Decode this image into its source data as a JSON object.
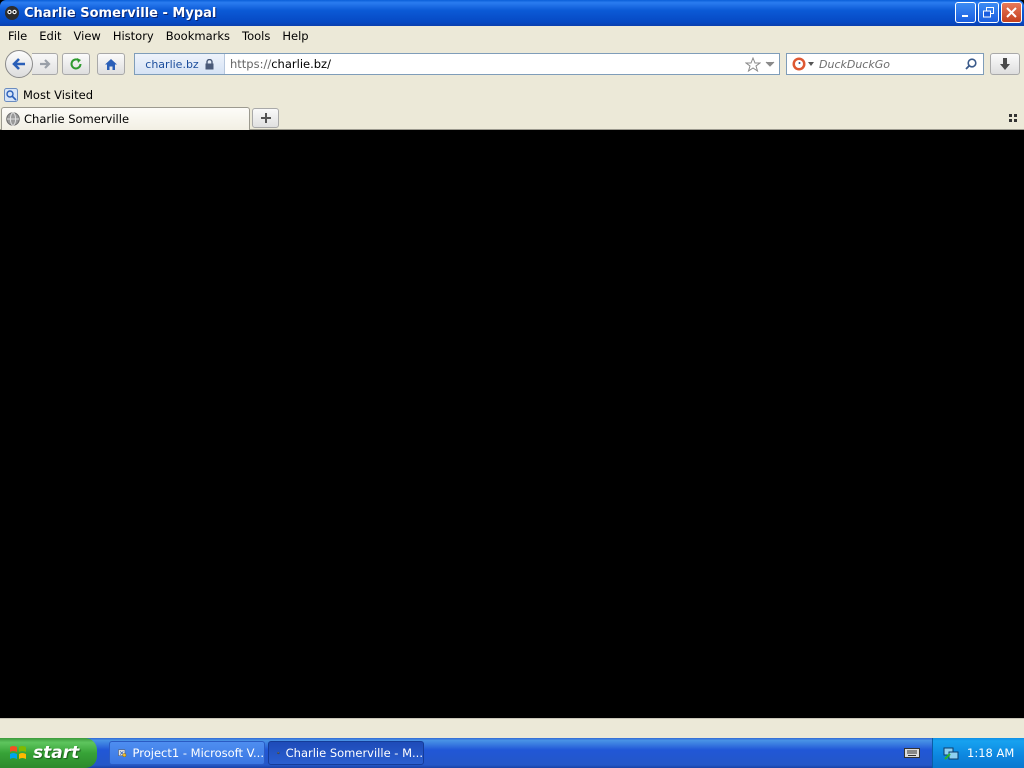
{
  "window": {
    "title": "Charlie Somerville - Mypal"
  },
  "menu": {
    "items": [
      {
        "label": "File"
      },
      {
        "label": "Edit"
      },
      {
        "label": "View"
      },
      {
        "label": "History"
      },
      {
        "label": "Bookmarks"
      },
      {
        "label": "Tools"
      },
      {
        "label": "Help"
      }
    ]
  },
  "navbar": {
    "identity_label": "charlie.bz",
    "url_scheme": "https://",
    "url_rest": "charlie.bz/",
    "search_engine": "DuckDuckGo",
    "search_placeholder": "DuckDuckGo"
  },
  "bookmarks": {
    "items": [
      {
        "label": "Most Visited"
      }
    ]
  },
  "tabs": [
    {
      "label": "Charlie Somerville",
      "active": true
    }
  ],
  "taskbar": {
    "start_label": "start",
    "tasks": [
      {
        "label": "Project1 - Microsoft V...",
        "active": false
      },
      {
        "label": "Charlie Somerville - M...",
        "active": true
      }
    ],
    "clock": "1:18 AM"
  },
  "colors": {
    "titlebar": "#0b5ad6",
    "chrome": "#ece9d8",
    "content": "#000000",
    "taskbar": "#2457c8",
    "start": "#37a337"
  }
}
